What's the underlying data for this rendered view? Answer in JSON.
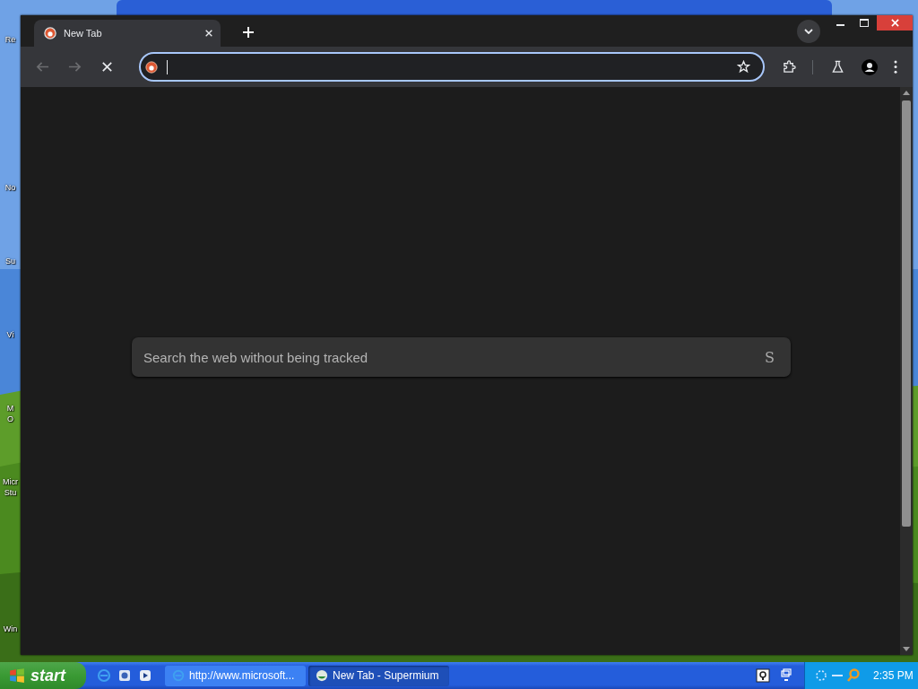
{
  "desktop": {
    "icon_labels": [
      {
        "lines": [
          "Re"
        ]
      },
      {
        "lines": [
          "No"
        ]
      },
      {
        "lines": [
          "Su"
        ]
      },
      {
        "lines": [
          "Vi"
        ]
      },
      {
        "lines": [
          "M",
          "O"
        ]
      },
      {
        "lines": [
          "Micr",
          "Stu"
        ]
      },
      {
        "lines": [
          "Win"
        ]
      }
    ]
  },
  "browser": {
    "tabs": [
      {
        "title": "New Tab",
        "selected": true
      }
    ],
    "nav_buttons": [
      {
        "kind": "back",
        "disabled": true
      },
      {
        "kind": "forward",
        "disabled": true
      },
      {
        "kind": "stop",
        "disabled": false
      }
    ],
    "address_bar": {
      "focused": true
    },
    "search": {
      "placeholder": "Search the web without being tracked",
      "button": "S"
    }
  },
  "taskbar": {
    "start": "start",
    "tasks": [
      {
        "label": "http://www.microsoft...",
        "selected": false
      },
      {
        "label": "New Tab - Supermium",
        "selected": true
      }
    ],
    "clock": "2:35 PM"
  }
}
